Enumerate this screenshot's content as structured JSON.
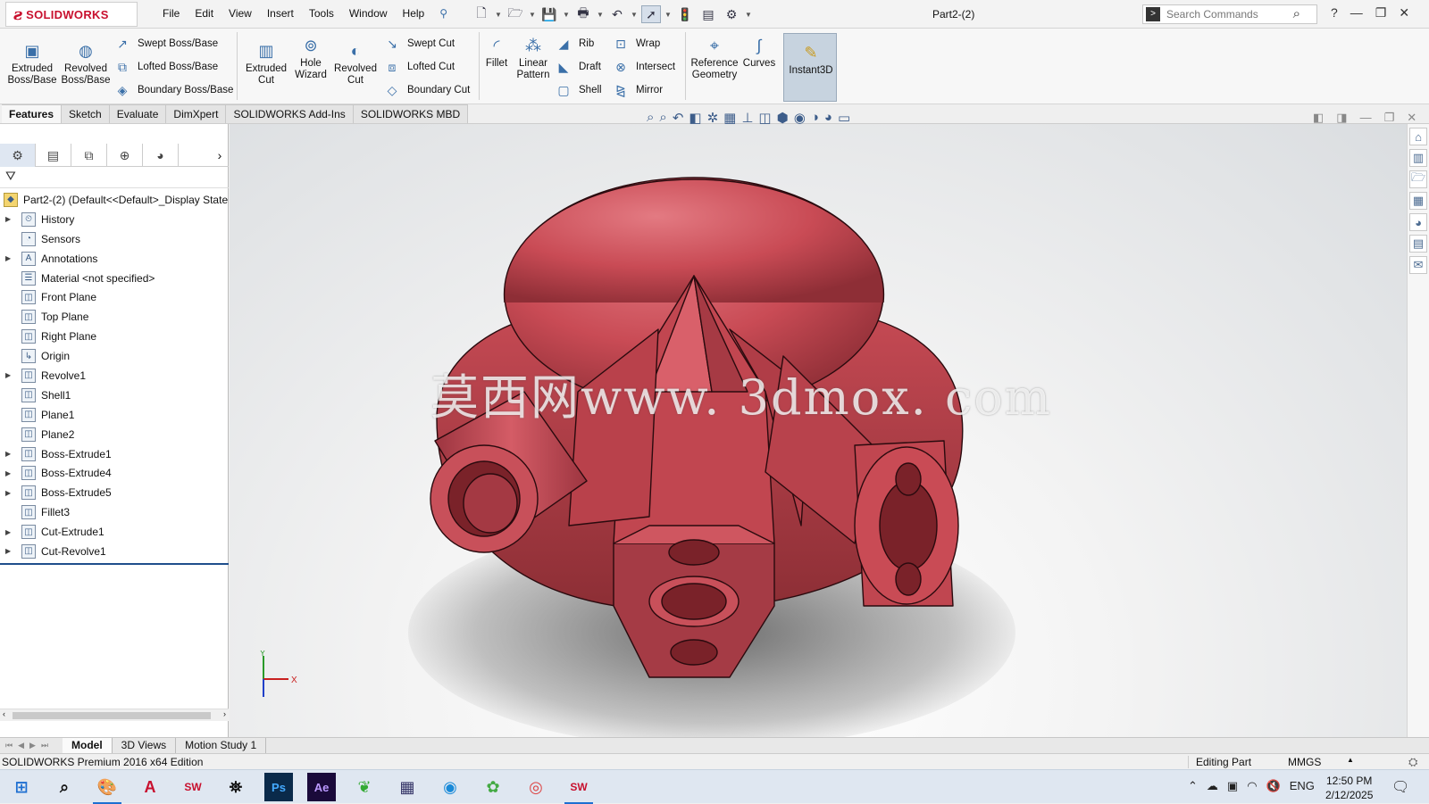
{
  "app": {
    "logo_text": "SOLIDWORKS",
    "doc_title": "Part2-(2)",
    "menu": [
      "File",
      "Edit",
      "View",
      "Insert",
      "Tools",
      "Window",
      "Help"
    ],
    "search_placeholder": "Search Commands"
  },
  "ribbon": {
    "extruded_boss": "Extruded Boss/Base",
    "revolved_boss": "Revolved Boss/Base",
    "swept_boss": "Swept Boss/Base",
    "lofted_boss": "Lofted Boss/Base",
    "boundary_boss": "Boundary Boss/Base",
    "extruded_cut": "Extruded Cut",
    "hole_wizard": "Hole Wizard",
    "revolved_cut": "Revolved Cut",
    "swept_cut": "Swept Cut",
    "lofted_cut": "Lofted Cut",
    "boundary_cut": "Boundary Cut",
    "fillet": "Fillet",
    "linear_pattern": "Linear Pattern",
    "rib": "Rib",
    "draft": "Draft",
    "shell": "Shell",
    "wrap": "Wrap",
    "intersect": "Intersect",
    "mirror": "Mirror",
    "reference_geometry": "Reference Geometry",
    "curves": "Curves",
    "instant3d": "Instant3D"
  },
  "tabs": [
    "Features",
    "Sketch",
    "Evaluate",
    "DimXpert",
    "SOLIDWORKS Add-Ins",
    "SOLIDWORKS MBD"
  ],
  "tree": {
    "root": "Part2-(2)  (Default<<Default>_Display State",
    "items": [
      {
        "label": "History",
        "expandable": true
      },
      {
        "label": "Sensors",
        "expandable": false
      },
      {
        "label": "Annotations",
        "expandable": true
      },
      {
        "label": "Material <not specified>",
        "expandable": false
      },
      {
        "label": "Front Plane",
        "expandable": false
      },
      {
        "label": "Top Plane",
        "expandable": false
      },
      {
        "label": "Right Plane",
        "expandable": false
      },
      {
        "label": "Origin",
        "expandable": false
      },
      {
        "label": "Revolve1",
        "expandable": true
      },
      {
        "label": "Shell1",
        "expandable": false
      },
      {
        "label": "Plane1",
        "expandable": false
      },
      {
        "label": "Plane2",
        "expandable": false
      },
      {
        "label": "Boss-Extrude1",
        "expandable": true
      },
      {
        "label": "Boss-Extrude4",
        "expandable": true
      },
      {
        "label": "Boss-Extrude5",
        "expandable": true
      },
      {
        "label": "Fillet3",
        "expandable": false
      },
      {
        "label": "Cut-Extrude1",
        "expandable": true
      },
      {
        "label": "Cut-Revolve1",
        "expandable": true
      }
    ]
  },
  "viewport": {
    "watermark": "莫西网www. 3dmox. com",
    "axis_x": "X",
    "axis_y": "Y",
    "part_color": "#c94b55"
  },
  "bottom_tabs": [
    "Model",
    "3D Views",
    "Motion Study 1"
  ],
  "status": {
    "product": "SOLIDWORKS Premium 2016 x64 Edition",
    "mode": "Editing Part",
    "units": "MMGS"
  },
  "taskbar": {
    "lang": "ENG",
    "time": "12:50 PM",
    "date": "2/12/2025"
  }
}
